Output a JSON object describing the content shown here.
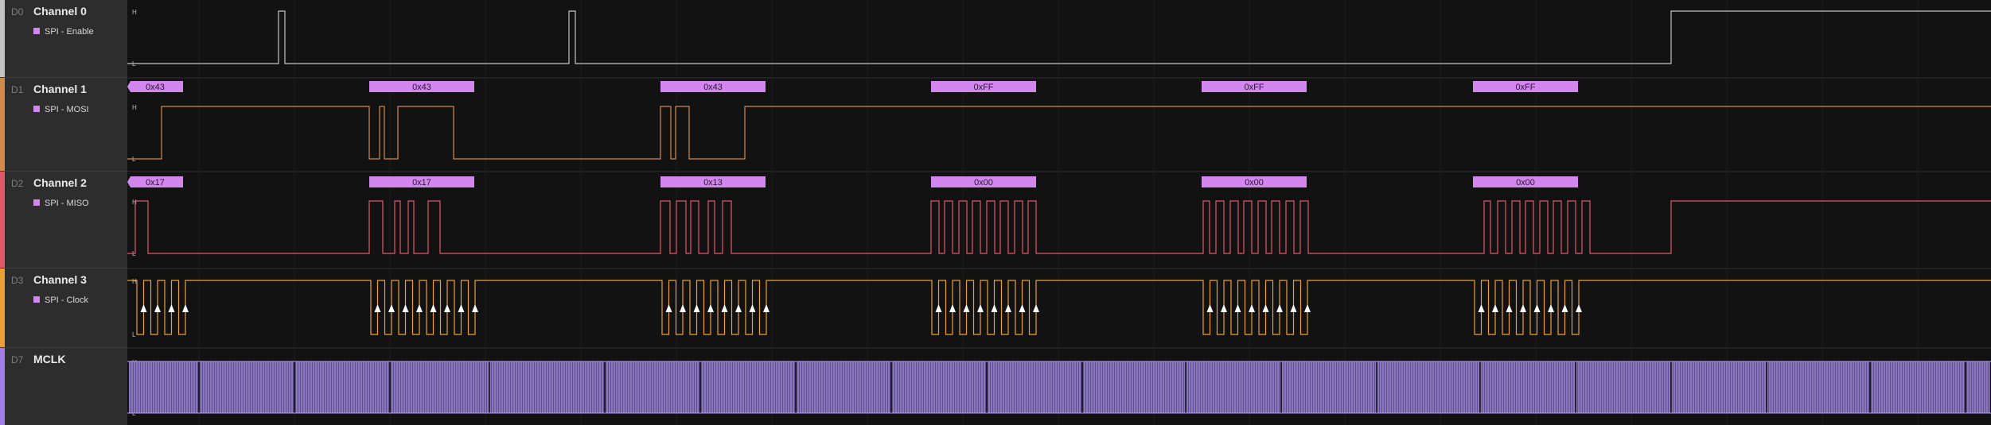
{
  "channels": [
    {
      "id": "D0",
      "name": "Channel 0",
      "analyzer": "SPI - Enable",
      "color": "#c4c4c4"
    },
    {
      "id": "D1",
      "name": "Channel 1",
      "analyzer": "SPI - MOSI",
      "color": "#d28a4b"
    },
    {
      "id": "D2",
      "name": "Channel 2",
      "analyzer": "SPI - MISO",
      "color": "#e0586a"
    },
    {
      "id": "D3",
      "name": "Channel 3",
      "analyzer": "SPI - Clock",
      "color": "#eaa037"
    },
    {
      "id": "D7",
      "name": "MCLK",
      "analyzer": "",
      "color": "#a07ee6"
    }
  ],
  "level_labels": {
    "high": "H",
    "low": "L"
  },
  "analyzer_color": "#d386ee",
  "mosi_bytes": [
    "0x43",
    "0x43",
    "0x43",
    "0xFF",
    "0xFF",
    "0xFF"
  ],
  "miso_bytes": [
    "0x17",
    "0x17",
    "0x13",
    "0x00",
    "0x00",
    "0x00"
  ]
}
